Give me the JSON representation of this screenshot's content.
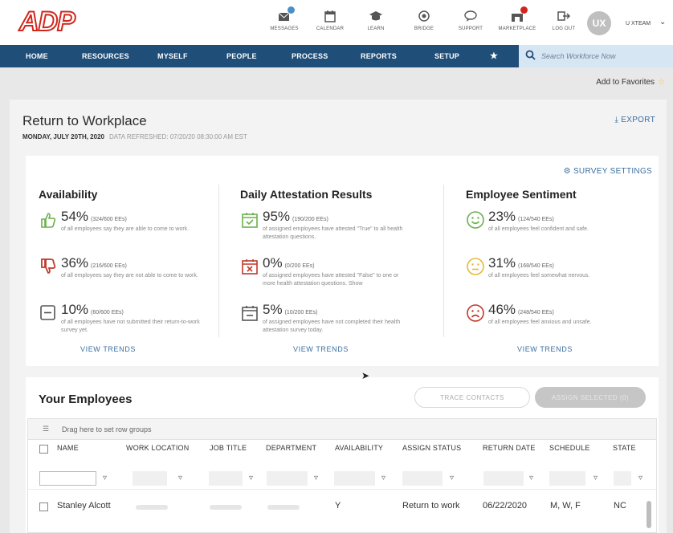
{
  "header": {
    "logo_text": "ADP",
    "utilities": [
      {
        "label": "MESSAGES",
        "icon": "messages-icon"
      },
      {
        "label": "CALENDAR",
        "icon": "calendar-icon"
      },
      {
        "label": "LEARN",
        "icon": "graduation-cap-icon"
      },
      {
        "label": "BRIDGE",
        "icon": "bridge-chat-icon"
      },
      {
        "label": "SUPPORT",
        "icon": "support-chat-icon"
      },
      {
        "label": "MARKETPLACE",
        "icon": "marketplace-icon"
      },
      {
        "label": "LOG OUT",
        "icon": "logout-icon"
      }
    ],
    "user_initials": "UX",
    "user_name": "U XTEAM"
  },
  "nav": {
    "items": [
      "HOME",
      "RESOURCES",
      "MYSELF",
      "PEOPLE",
      "PROCESS",
      "REPORTS",
      "SETUP",
      "★"
    ],
    "search_placeholder": "Search Workforce Now"
  },
  "favorites_label": "Add to Favorites",
  "page": {
    "title": "Return to Workplace",
    "date": "MONDAY, JULY 20TH, 2020",
    "refreshed": "DATA REFRESHED: 07/20/20 08:30:00 AM EST",
    "export_label": "EXPORT",
    "survey_settings_label": "SURVEY SETTINGS"
  },
  "sections": [
    {
      "title": "Availability",
      "trends_label": "VIEW TRENDS",
      "stats": [
        {
          "pct": "54%",
          "count": "(324/600 EEs)",
          "desc": "of all employees say they are able to come to work.",
          "icon": "thumbs-up-icon"
        },
        {
          "pct": "36%",
          "count": "(216/600 EEs)",
          "desc": "of all employees say they are not able to come to work.",
          "icon": "thumbs-down-icon"
        },
        {
          "pct": "10%",
          "count": "(60/600 EEs)",
          "desc": "of all employees have not submitted their return-to-work survey yet.",
          "icon": "minus-box-icon"
        }
      ]
    },
    {
      "title": "Daily Attestation Results",
      "trends_label": "VIEW TRENDS",
      "stats": [
        {
          "pct": "95%",
          "count": "(190/200 EEs)",
          "desc": "of assigned employees have attested \"True\" to all health attestation questions.",
          "icon": "calendar-check-icon"
        },
        {
          "pct": "0%",
          "count": "(0/200 EEs)",
          "desc": "of assigned employees have attested \"False\" to one or more health attestation questions. Show",
          "icon": "calendar-x-icon"
        },
        {
          "pct": "5%",
          "count": "(10/200 EEs)",
          "desc": "of assigned employees have not completed their health attestation survey today.",
          "icon": "calendar-minus-icon"
        }
      ]
    },
    {
      "title": "Employee Sentiment",
      "trends_label": "VIEW TRENDS",
      "stats": [
        {
          "pct": "23%",
          "count": "(124/540 EEs)",
          "desc": "of all employees feel confident and safe.",
          "icon": "smile-face-icon"
        },
        {
          "pct": "31%",
          "count": "(168/540 EEs)",
          "desc": "of all employees feel somewhat nervous.",
          "icon": "neutral-face-icon"
        },
        {
          "pct": "46%",
          "count": "(248/540 EEs)",
          "desc": "of all employees feel anxious and unsafe.",
          "icon": "sad-face-icon"
        }
      ]
    }
  ],
  "employees": {
    "title": "Your Employees",
    "trace_label": "TRACE CONTACTS",
    "assign_label": "ASSIGN SELECTED (0)",
    "group_hint": "Drag here to set row groups",
    "columns": [
      "NAME",
      "WORK LOCATION",
      "JOB TITLE",
      "DEPARTMENT",
      "AVAILABILITY",
      "ASSIGN STATUS",
      "RETURN DATE",
      "SCHEDULE",
      "STATE"
    ],
    "rows": [
      {
        "name": "Stanley Alcott",
        "availability": "Y",
        "assign_status": "Return to work",
        "return_date": "06/22/2020",
        "schedule": "M, W, F",
        "state": "NC"
      }
    ]
  },
  "colors": {
    "brand_red": "#d0271d",
    "nav_blue": "#1f4e79",
    "link_blue": "#3a6fa0",
    "positive_green": "#6bb04a",
    "negative_red": "#c0392b",
    "neutral_yellow": "#e6b83a"
  }
}
